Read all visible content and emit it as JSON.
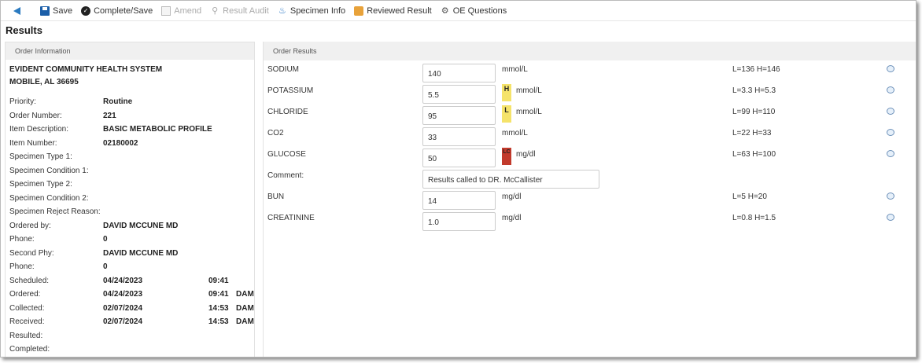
{
  "toolbar": {
    "save": "Save",
    "complete_save": "Complete/Save",
    "amend": "Amend",
    "result_audit": "Result Audit",
    "specimen_info": "Specimen Info",
    "reviewed_result": "Reviewed Result",
    "oe_questions": "OE Questions"
  },
  "page_title": "Results",
  "order_info": {
    "header": "Order Information",
    "org_name": "EVIDENT COMMUNITY HEALTH SYSTEM",
    "org_city": "MOBILE, AL 36695",
    "rows": [
      {
        "label": "Priority:",
        "value": "Routine",
        "time": "",
        "zone": ""
      },
      {
        "label": "Order Number:",
        "value": "221",
        "time": "",
        "zone": ""
      },
      {
        "label": "Item Description:",
        "value": "BASIC METABOLIC PROFILE",
        "time": "",
        "zone": ""
      },
      {
        "label": "Item Number:",
        "value": "02180002",
        "time": "",
        "zone": ""
      },
      {
        "label": "Specimen Type 1:",
        "value": "",
        "time": "",
        "zone": ""
      },
      {
        "label": "Specimen Condition 1:",
        "value": "",
        "time": "",
        "zone": ""
      },
      {
        "label": "Specimen Type 2:",
        "value": "",
        "time": "",
        "zone": ""
      },
      {
        "label": "Specimen Condition 2:",
        "value": "",
        "time": "",
        "zone": ""
      },
      {
        "label": "Specimen Reject Reason:",
        "value": "",
        "time": "",
        "zone": ""
      },
      {
        "label": "Ordered by:",
        "value": "DAVID MCCUNE MD",
        "time": "",
        "zone": ""
      },
      {
        "label": "Phone:",
        "value": "0",
        "time": "",
        "zone": ""
      },
      {
        "label": "Second Phy:",
        "value": "DAVID MCCUNE MD",
        "time": "",
        "zone": ""
      },
      {
        "label": "Phone:",
        "value": "0",
        "time": "",
        "zone": ""
      },
      {
        "label": "Scheduled:",
        "value": "04/24/2023",
        "time": "09:41",
        "zone": ""
      },
      {
        "label": "Ordered:",
        "value": "04/24/2023",
        "time": "09:41",
        "zone": "DAM"
      },
      {
        "label": "Collected:",
        "value": "02/07/2024",
        "time": "14:53",
        "zone": "DAM"
      },
      {
        "label": "Received:",
        "value": "02/07/2024",
        "time": "14:53",
        "zone": "DAM"
      },
      {
        "label": "Resulted:",
        "value": "",
        "time": "",
        "zone": ""
      },
      {
        "label": "Completed:",
        "value": "",
        "time": "",
        "zone": ""
      }
    ]
  },
  "order_results": {
    "header": "Order Results",
    "comment_label": "Comment:",
    "comment_value": "Results called to DR. McCallister",
    "tests": [
      {
        "name": "SODIUM",
        "value": "140",
        "flag": "",
        "unit": "mmol/L",
        "range": "L=136 H=146"
      },
      {
        "name": "POTASSIUM",
        "value": "5.5",
        "flag": "H",
        "unit": "mmol/L",
        "range": "L=3.3 H=5.3"
      },
      {
        "name": "CHLORIDE",
        "value": "95",
        "flag": "L",
        "unit": "mmol/L",
        "range": "L=99 H=110"
      },
      {
        "name": "CO2",
        "value": "33",
        "flag": "",
        "unit": "mmol/L",
        "range": "L=22 H=33"
      },
      {
        "name": "GLUCOSE",
        "value": "50",
        "flag": "LC",
        "unit": "mg/dl",
        "range": "L=63 H=100"
      },
      {
        "name": "BUN",
        "value": "14",
        "flag": "",
        "unit": "mg/dl",
        "range": "L=5 H=20"
      },
      {
        "name": "CREATININE",
        "value": "1.0",
        "flag": "",
        "unit": "mg/dl",
        "range": "L=0.8 H=1.5"
      }
    ]
  },
  "colors": {
    "accent": "#1b5ea8",
    "flag_high_low": "#f5e36a",
    "flag_critical": "#c23a2c"
  }
}
